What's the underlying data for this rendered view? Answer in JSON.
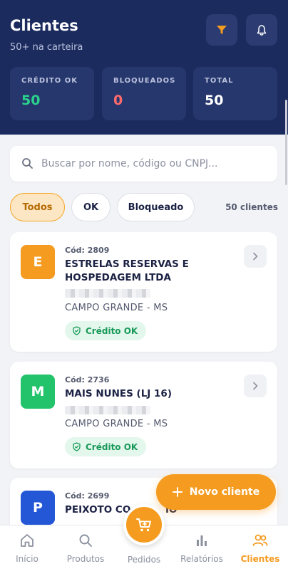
{
  "header": {
    "title": "Clientes",
    "subtitle": "50+ na carteira",
    "filter_icon": "filter-icon",
    "bell_icon": "bell-icon"
  },
  "stats": [
    {
      "label": "CRÉDITO OK",
      "value": "50",
      "color": "#2bd18b"
    },
    {
      "label": "BLOQUEADOS",
      "value": "0",
      "color": "#ff6b6b"
    },
    {
      "label": "TOTAL",
      "value": "50",
      "color": "#ffffff"
    }
  ],
  "search": {
    "placeholder": "Buscar por nome, código ou CNPJ..."
  },
  "filters": {
    "chips": [
      "Todos",
      "OK",
      "Bloqueado"
    ],
    "selected": "Todos",
    "count": "50 clientes"
  },
  "clients": [
    {
      "initial": "E",
      "avatar_color": "#f59b1f",
      "code": "Cód: 2809",
      "name": "ESTRELAS RESERVAS E HOSPEDAGEM LTDA",
      "city": "CAMPO GRANDE - MS",
      "status": "Crédito OK"
    },
    {
      "initial": "M",
      "avatar_color": "#22c36b",
      "code": "Cód: 2736",
      "name": "MAIS NUNES  (LJ 16)",
      "city": "CAMPO GRANDE - MS",
      "status": "Crédito OK"
    },
    {
      "initial": "P",
      "avatar_color": "#2457d6",
      "code": "Cód: 2699",
      "name": "PEIXOTO CO",
      "name_tail": "IO"
    }
  ],
  "fab": {
    "label": "Novo cliente"
  },
  "nav": [
    {
      "label": "Início",
      "icon": "home-icon"
    },
    {
      "label": "Produtos",
      "icon": "search-icon"
    },
    {
      "label": "Pedidos",
      "icon": "cart-icon"
    },
    {
      "label": "Relatórios",
      "icon": "bar-chart-icon"
    },
    {
      "label": "Clientes",
      "icon": "users-icon",
      "active": true
    }
  ],
  "colors": {
    "primary": "#1b2b5e",
    "accent": "#f59b1f",
    "success": "#1a9a59"
  }
}
